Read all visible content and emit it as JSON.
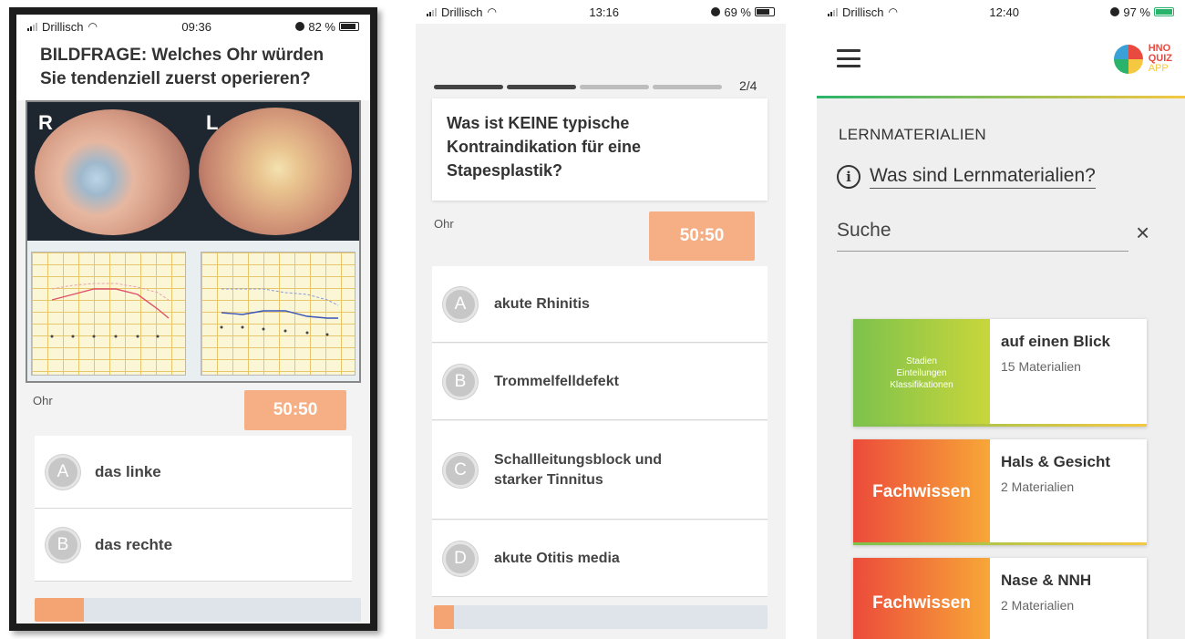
{
  "screen1": {
    "status": {
      "carrier": "Drillisch",
      "time": "09:36",
      "battery": "82 %",
      "battery_level": 0.82
    },
    "question": "BILDFRAGE: Welches Ohr würden Sie tendenziell zuerst operieren?",
    "image_labels": {
      "right": "R",
      "left": "L"
    },
    "category": "Ohr",
    "joker_label": "50:50",
    "answers": [
      {
        "letter": "A",
        "text": "das linke"
      },
      {
        "letter": "B",
        "text": "das rechte"
      }
    ],
    "progress": 0.15
  },
  "screen2": {
    "status": {
      "carrier": "Drillisch",
      "time": "13:16",
      "battery": "69 %",
      "battery_level": 0.69
    },
    "step_counter": "2/4",
    "steps_done": 2,
    "steps_total": 4,
    "question": "Was ist KEINE typische Kontraindikation für eine Stapesplastik?",
    "category": "Ohr",
    "joker_label": "50:50",
    "answers": [
      {
        "letter": "A",
        "text": "akute Rhinitis"
      },
      {
        "letter": "B",
        "text": "Trommelfelldefekt"
      },
      {
        "letter": "C",
        "text": "Schallleitungsblock und starker Tinnitus"
      },
      {
        "letter": "D",
        "text": "akute Otitis media"
      }
    ],
    "progress": 0.06
  },
  "screen3": {
    "status": {
      "carrier": "Drillisch",
      "time": "12:40",
      "battery": "97 %",
      "battery_level": 0.97
    },
    "logo": {
      "line1": "HNO",
      "line2": "QUIZ",
      "line3": "APP"
    },
    "section_title": "LERNMATERIALIEN",
    "info_link": "Was sind Lernmaterialien?",
    "search_placeholder": "Suche",
    "clear_icon": "×",
    "materials": [
      {
        "thumb": "Stadien Einteilungen Klassifikationen",
        "title": "auf einen Blick",
        "count": "15 Materialien"
      },
      {
        "thumb": "Fachwissen",
        "title": "Hals & Gesicht",
        "count": "2 Materialien"
      },
      {
        "thumb": "Fachwissen",
        "title": "Nase & NNH",
        "count": "2 Materialien"
      }
    ]
  }
}
